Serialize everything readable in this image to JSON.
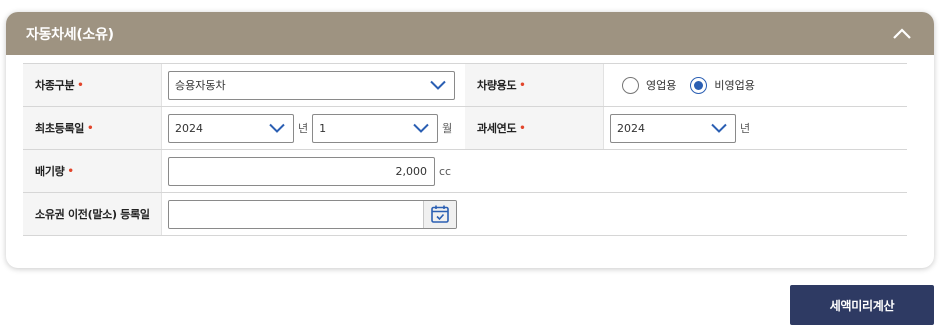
{
  "panel": {
    "title": "자동차세(소유)"
  },
  "fields": {
    "vehicle_type": {
      "label": "차종구분",
      "value": "승용자동차"
    },
    "vehicle_use": {
      "label": "차량용도",
      "options": [
        {
          "label": "영업용",
          "checked": false
        },
        {
          "label": "비영업용",
          "checked": true
        }
      ]
    },
    "first_registration": {
      "label": "최초등록일",
      "year": "2024",
      "year_unit": "년",
      "month": "1",
      "month_unit": "월"
    },
    "tax_year": {
      "label": "과세연도",
      "value": "2024",
      "unit": "년"
    },
    "displacement": {
      "label": "배기량",
      "value": "2,000",
      "unit": "cc"
    },
    "transfer_date": {
      "label": "소유권 이전(말소) 등록일",
      "value": ""
    }
  },
  "required_mark": "•",
  "calc_button": {
    "label": "세액미리계산"
  },
  "colors": {
    "header_bg": "#9e9381",
    "button_bg": "#2e3a63",
    "required": "#e2452b",
    "radio_on": "#2b5fb3"
  }
}
